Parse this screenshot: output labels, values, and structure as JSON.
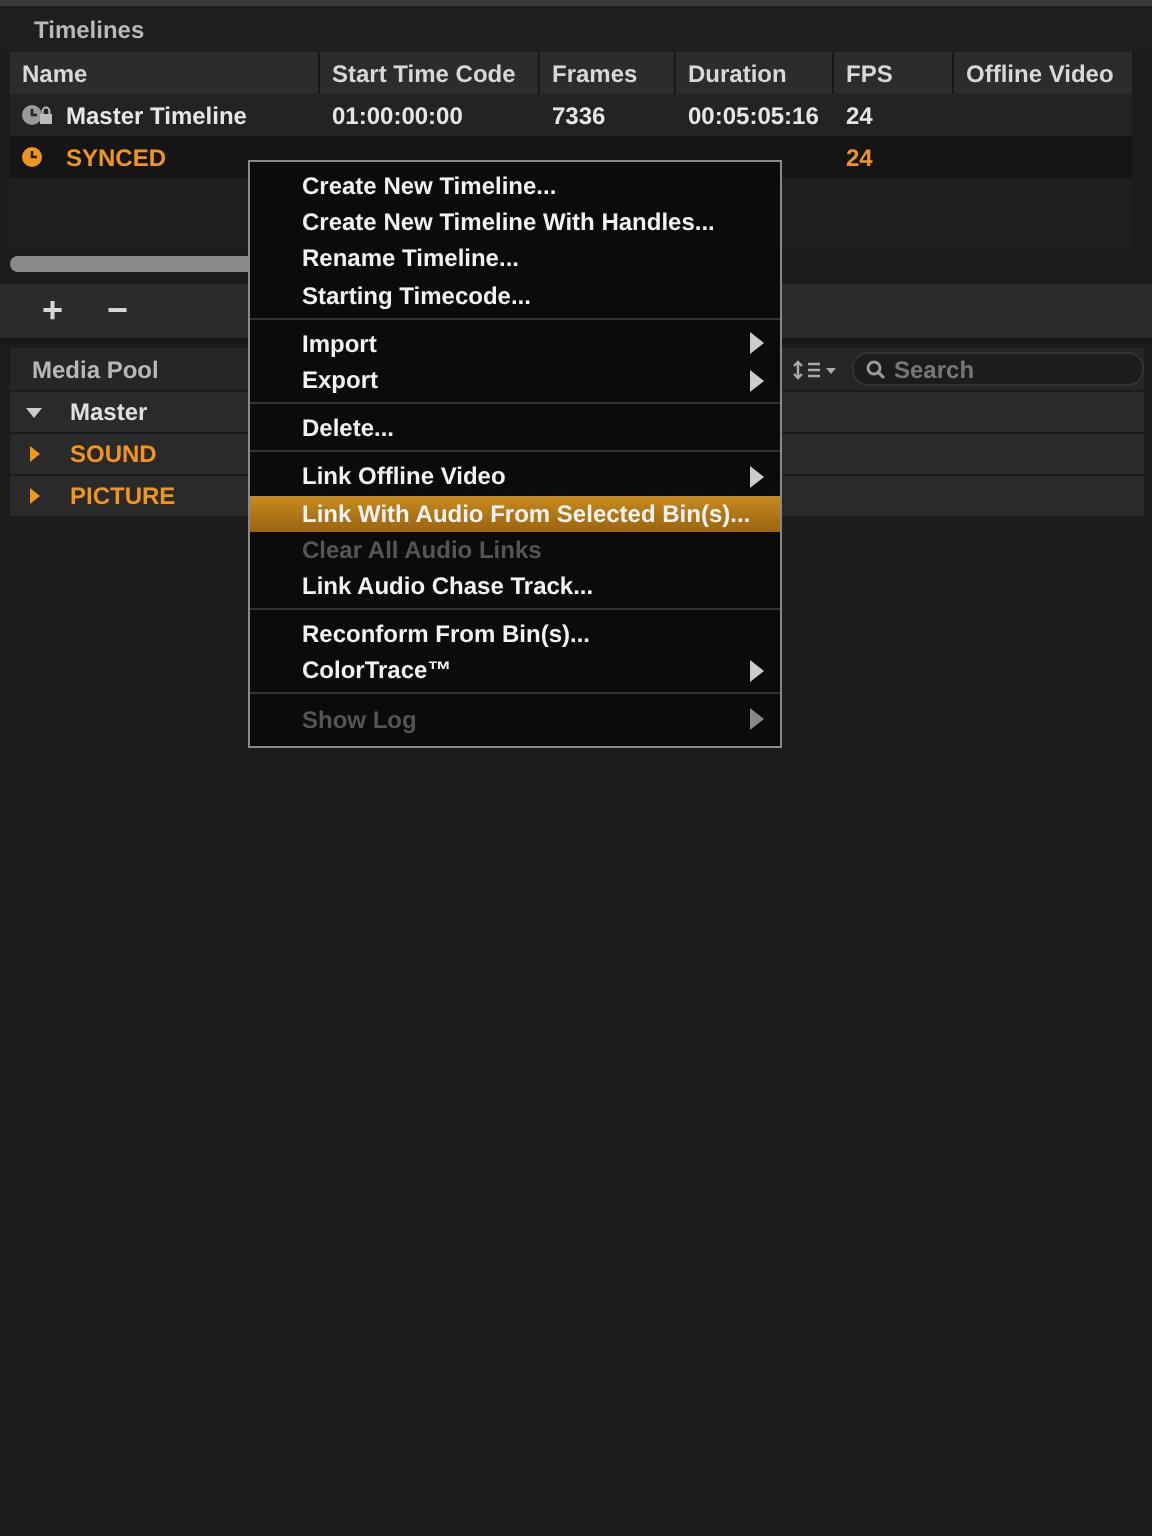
{
  "timelines_panel": {
    "title": "Timelines",
    "table": {
      "columns": [
        "Name",
        "Start Time Code",
        "Frames",
        "Duration",
        "FPS",
        "Offline Video"
      ],
      "rows": [
        {
          "kind": "master",
          "selected": false,
          "name": "Master Timeline",
          "start_time_code": "01:00:00:00",
          "frames": "7336",
          "duration": "00:05:05:16",
          "fps": "24"
        },
        {
          "kind": "synced",
          "selected": true,
          "name": "SYNCED",
          "fps": "24"
        }
      ]
    },
    "toolbar": {
      "add": "+",
      "remove": "−"
    }
  },
  "media_pool": {
    "title": "Media Pool",
    "search": {
      "placeholder": "Search"
    },
    "bins": [
      {
        "name": "Master",
        "expanded": true,
        "highlighted": false
      },
      {
        "name": "SOUND",
        "expanded": false,
        "highlighted": true
      },
      {
        "name": "PICTURE",
        "expanded": false,
        "highlighted": true
      }
    ]
  },
  "context_menu": {
    "items": [
      {
        "kind": "item",
        "label": "Create New Timeline...",
        "submenu": false,
        "disabled": false,
        "selected": false
      },
      {
        "kind": "item",
        "label": "Create New Timeline With Handles...",
        "submenu": false,
        "disabled": false,
        "selected": false
      },
      {
        "kind": "item",
        "label": "Rename Timeline...",
        "submenu": false,
        "disabled": false,
        "selected": false
      },
      {
        "kind": "item",
        "label": "Starting Timecode...",
        "submenu": false,
        "disabled": false,
        "selected": false
      },
      {
        "kind": "separator"
      },
      {
        "kind": "item",
        "label": "Import",
        "submenu": true,
        "disabled": false,
        "selected": false
      },
      {
        "kind": "item",
        "label": "Export",
        "submenu": true,
        "disabled": false,
        "selected": false
      },
      {
        "kind": "separator"
      },
      {
        "kind": "item",
        "label": "Delete...",
        "submenu": false,
        "disabled": false,
        "selected": false
      },
      {
        "kind": "separator"
      },
      {
        "kind": "item",
        "label": "Link Offline Video",
        "submenu": true,
        "disabled": false,
        "selected": false
      },
      {
        "kind": "item",
        "label": "Link With Audio From Selected Bin(s)...",
        "submenu": false,
        "disabled": false,
        "selected": true
      },
      {
        "kind": "item",
        "label": "Clear All Audio Links",
        "submenu": false,
        "disabled": true,
        "selected": false
      },
      {
        "kind": "item",
        "label": "Link Audio Chase Track...",
        "submenu": false,
        "disabled": false,
        "selected": false
      },
      {
        "kind": "separator"
      },
      {
        "kind": "item",
        "label": "Reconform From Bin(s)...",
        "submenu": false,
        "disabled": false,
        "selected": false
      },
      {
        "kind": "item",
        "label": "ColorTrace™",
        "submenu": true,
        "disabled": false,
        "selected": false
      },
      {
        "kind": "separator"
      },
      {
        "kind": "item",
        "label": "Show Log",
        "submenu": true,
        "disabled": true,
        "selected": false
      }
    ]
  }
}
